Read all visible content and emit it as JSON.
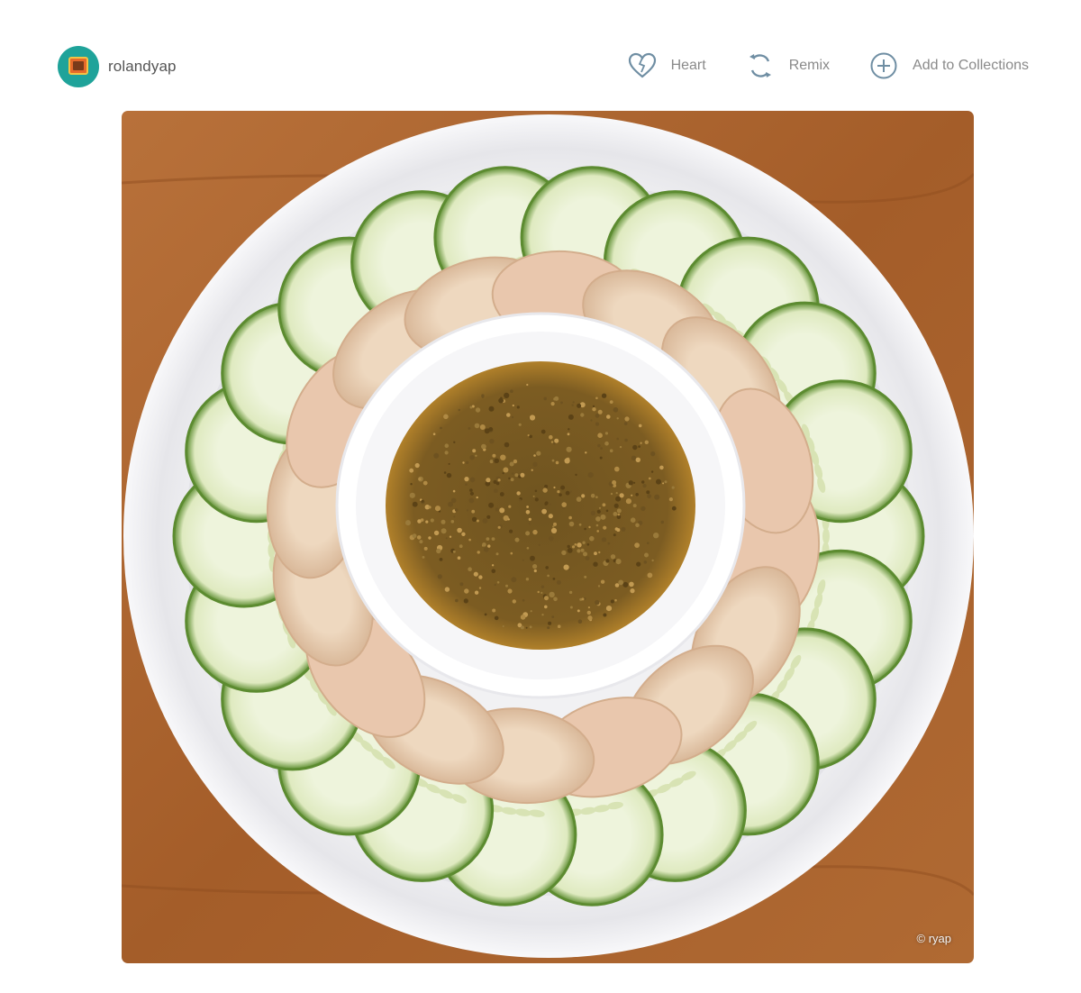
{
  "user": {
    "username": "rolandyap"
  },
  "actions": {
    "heart": "Heart",
    "remix": "Remix",
    "collections": "Add to Collections"
  },
  "photo": {
    "credit": "© ryap"
  },
  "colors": {
    "table": "#a9622c",
    "plate": "#f2f2f4",
    "cucumber_skin": "#6a9a3a",
    "cucumber_flesh": "#e7f0d2",
    "chicken": "#ead0b4",
    "sauce": "#7a5a1f",
    "icon": "#6f8ea3"
  }
}
